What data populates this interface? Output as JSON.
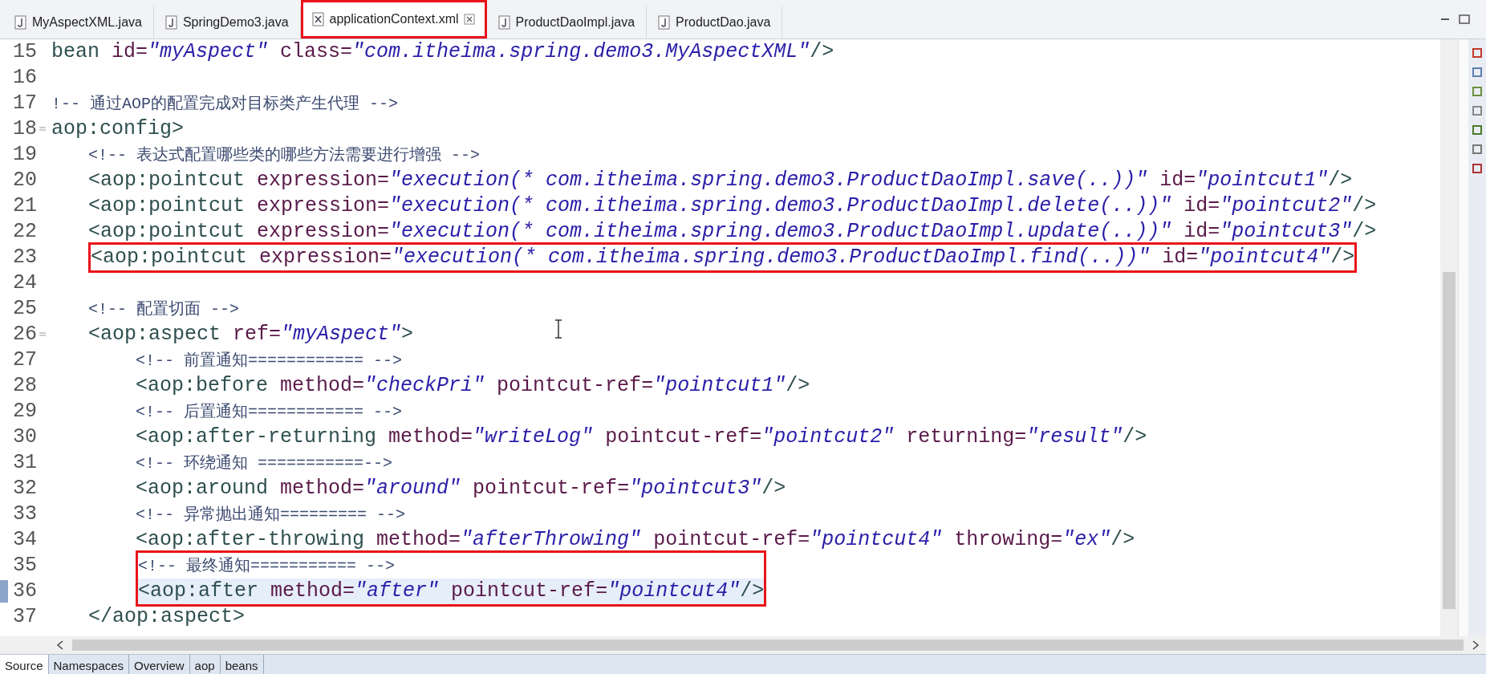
{
  "editor_tabs": [
    {
      "label": "MyAspectXML.java",
      "kind": "java",
      "selected": false,
      "boxed": false
    },
    {
      "label": "SpringDemo3.java",
      "kind": "java",
      "selected": false,
      "boxed": false
    },
    {
      "label": "applicationContext.xml",
      "kind": "xml",
      "selected": true,
      "boxed": true
    },
    {
      "label": "ProductDaoImpl.java",
      "kind": "java",
      "selected": false,
      "boxed": false
    },
    {
      "label": "ProductDao.java",
      "kind": "java",
      "selected": false,
      "boxed": false
    }
  ],
  "code_lines": [
    {
      "number": "15",
      "tokens": [
        {
          "kind": "tag",
          "text": "bean"
        },
        {
          "kind": "attr",
          "text": " id="
        },
        {
          "kind": "val",
          "text": "\"myAspect\""
        },
        {
          "kind": "attr",
          "text": " class="
        },
        {
          "kind": "val",
          "text": "\"com.itheima.spring.demo3.MyAspectXML\""
        },
        {
          "kind": "tag",
          "text": "/>"
        }
      ]
    },
    {
      "number": "16"
    },
    {
      "number": "17",
      "tokens": [
        {
          "kind": "com",
          "text": "!-- 通过AOP的配置完成对目标类产生代理 -->"
        }
      ]
    },
    {
      "number": "18",
      "foldable": true,
      "tokens": [
        {
          "kind": "tag",
          "text": "aop:config>"
        }
      ],
      "children": [
        {
          "number": "19",
          "tokens": [
            {
              "kind": "com",
              "text": "<!-- 表达式配置哪些类的哪些方法需要进行增强 -->"
            }
          ]
        },
        {
          "number": "20",
          "tokens": [
            {
              "kind": "tag",
              "text": "<aop:pointcut"
            },
            {
              "kind": "attr",
              "text": " expression="
            },
            {
              "kind": "val",
              "text": "\"execution(* com.itheima.spring.demo3.ProductDaoImpl.save(..))\""
            },
            {
              "kind": "attr",
              "text": " id="
            },
            {
              "kind": "val",
              "text": "\"pointcut1\""
            },
            {
              "kind": "tag",
              "text": "/>"
            }
          ]
        },
        {
          "number": "21",
          "tokens": [
            {
              "kind": "tag",
              "text": "<aop:pointcut"
            },
            {
              "kind": "attr",
              "text": " expression="
            },
            {
              "kind": "val",
              "text": "\"execution(* com.itheima.spring.demo3.ProductDaoImpl.delete(..))\""
            },
            {
              "kind": "attr",
              "text": " id="
            },
            {
              "kind": "val",
              "text": "\"pointcut2\""
            },
            {
              "kind": "tag",
              "text": "/>"
            }
          ]
        },
        {
          "number": "22",
          "tokens": [
            {
              "kind": "tag",
              "text": "<aop:pointcut"
            },
            {
              "kind": "attr",
              "text": " expression="
            },
            {
              "kind": "val",
              "text": "\"execution(* com.itheima.spring.demo3.ProductDaoImpl.update(..))\""
            },
            {
              "kind": "attr",
              "text": " id="
            },
            {
              "kind": "val",
              "text": "\"pointcut3\""
            },
            {
              "kind": "tag",
              "text": "/>"
            }
          ]
        },
        {
          "number": "23",
          "boxed": true,
          "tokens": [
            {
              "kind": "tag",
              "text": "<aop:pointcut"
            },
            {
              "kind": "attr",
              "text": " expression="
            },
            {
              "kind": "val",
              "text": "\"execution(* com.itheima.spring.demo3.ProductDaoImpl.find(..))\""
            },
            {
              "kind": "attr",
              "text": " id="
            },
            {
              "kind": "val",
              "text": "\"pointcut4\""
            },
            {
              "kind": "tag",
              "text": "/>"
            }
          ]
        },
        {
          "number": "24"
        },
        {
          "number": "25",
          "tokens": [
            {
              "kind": "com",
              "text": "<!-- 配置切面 -->"
            }
          ]
        },
        {
          "number": "26",
          "foldable": true,
          "tokens": [
            {
              "kind": "tag",
              "text": "<aop:aspect"
            },
            {
              "kind": "attr",
              "text": " ref="
            },
            {
              "kind": "val",
              "text": "\"myAspect\""
            },
            {
              "kind": "tag",
              "text": ">"
            }
          ],
          "children": [
            {
              "number": "27",
              "tokens": [
                {
                  "kind": "com",
                  "text": "<!-- 前置通知============ -->"
                }
              ]
            },
            {
              "number": "28",
              "tokens": [
                {
                  "kind": "tag",
                  "text": "<aop:before"
                },
                {
                  "kind": "attr",
                  "text": " method="
                },
                {
                  "kind": "val",
                  "text": "\"checkPri\""
                },
                {
                  "kind": "attr",
                  "text": " pointcut-ref="
                },
                {
                  "kind": "val",
                  "text": "\"pointcut1\""
                },
                {
                  "kind": "tag",
                  "text": "/>"
                }
              ]
            },
            {
              "number": "29",
              "tokens": [
                {
                  "kind": "com",
                  "text": "<!-- 后置通知============ -->"
                }
              ]
            },
            {
              "number": "30",
              "tokens": [
                {
                  "kind": "tag",
                  "text": "<aop:after-returning"
                },
                {
                  "kind": "attr",
                  "text": " method="
                },
                {
                  "kind": "val",
                  "text": "\"writeLog\""
                },
                {
                  "kind": "attr",
                  "text": " pointcut-ref="
                },
                {
                  "kind": "val",
                  "text": "\"pointcut2\""
                },
                {
                  "kind": "attr",
                  "text": " returning="
                },
                {
                  "kind": "val",
                  "text": "\"result\""
                },
                {
                  "kind": "tag",
                  "text": "/>"
                }
              ]
            },
            {
              "number": "31",
              "tokens": [
                {
                  "kind": "com",
                  "text": "<!-- 环绕通知 ===========-->"
                }
              ]
            },
            {
              "number": "32",
              "tokens": [
                {
                  "kind": "tag",
                  "text": "<aop:around"
                },
                {
                  "kind": "attr",
                  "text": " method="
                },
                {
                  "kind": "val",
                  "text": "\"around\""
                },
                {
                  "kind": "attr",
                  "text": " pointcut-ref="
                },
                {
                  "kind": "val",
                  "text": "\"pointcut3\""
                },
                {
                  "kind": "tag",
                  "text": "/>"
                }
              ]
            },
            {
              "number": "33",
              "tokens": [
                {
                  "kind": "com",
                  "text": "<!-- 异常抛出通知========= -->"
                }
              ]
            },
            {
              "number": "34",
              "tokens": [
                {
                  "kind": "tag",
                  "text": "<aop:after-throwing"
                },
                {
                  "kind": "attr",
                  "text": " method="
                },
                {
                  "kind": "val",
                  "text": "\"afterThrowing\""
                },
                {
                  "kind": "attr",
                  "text": " pointcut-ref="
                },
                {
                  "kind": "val",
                  "text": "\"pointcut4\""
                },
                {
                  "kind": "attr",
                  "text": " throwing="
                },
                {
                  "kind": "val",
                  "text": "\"ex\""
                },
                {
                  "kind": "tag",
                  "text": "/>"
                }
              ]
            },
            {
              "number": "35",
              "boxed": true,
              "tokens": [
                {
                  "kind": "com",
                  "text": "<!-- 最终通知=========== -->"
                }
              ]
            },
            {
              "number": "36",
              "boxed": true,
              "current": true,
              "tokens": [
                {
                  "kind": "tag",
                  "text": "<aop:after"
                },
                {
                  "kind": "attr",
                  "text": " method="
                },
                {
                  "kind": "val",
                  "text": "\"after\""
                },
                {
                  "kind": "attr",
                  "text": " pointcut-ref="
                },
                {
                  "kind": "val",
                  "text": "\"pointcut4\""
                },
                {
                  "kind": "tag",
                  "text": "/>"
                }
              ]
            }
          ]
        },
        {
          "number": "37",
          "tokens": [
            {
              "kind": "tag",
              "text": "</aop:aspect>"
            }
          ]
        }
      ]
    }
  ],
  "page_tabs": [
    {
      "label": "Source",
      "selected": true
    },
    {
      "label": "Namespaces",
      "selected": false
    },
    {
      "label": "Overview",
      "selected": false
    },
    {
      "label": "aop",
      "selected": false
    },
    {
      "label": "beans",
      "selected": false
    }
  ]
}
